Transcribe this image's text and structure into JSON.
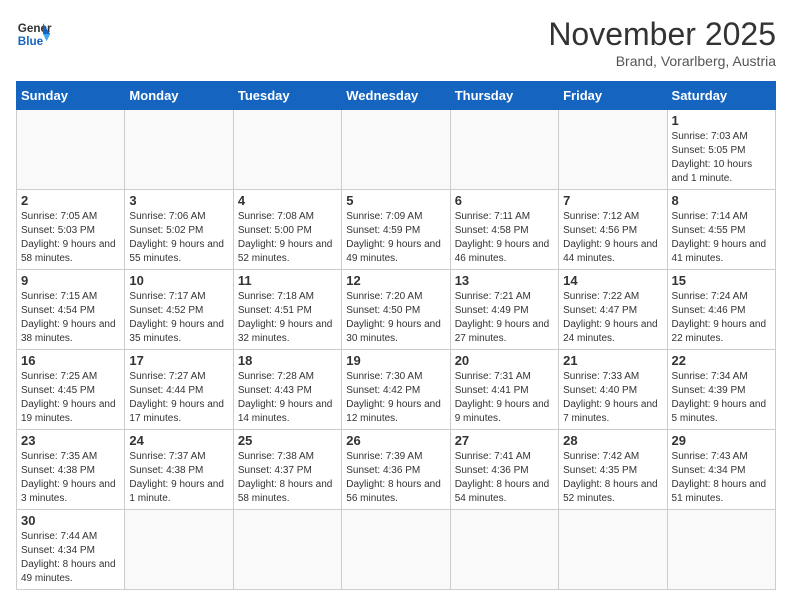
{
  "header": {
    "logo_general": "General",
    "logo_blue": "Blue",
    "month_title": "November 2025",
    "subtitle": "Brand, Vorarlberg, Austria"
  },
  "weekdays": [
    "Sunday",
    "Monday",
    "Tuesday",
    "Wednesday",
    "Thursday",
    "Friday",
    "Saturday"
  ],
  "weeks": [
    [
      {
        "day": "",
        "info": ""
      },
      {
        "day": "",
        "info": ""
      },
      {
        "day": "",
        "info": ""
      },
      {
        "day": "",
        "info": ""
      },
      {
        "day": "",
        "info": ""
      },
      {
        "day": "",
        "info": ""
      },
      {
        "day": "1",
        "info": "Sunrise: 7:03 AM\nSunset: 5:05 PM\nDaylight: 10 hours and 1 minute."
      }
    ],
    [
      {
        "day": "2",
        "info": "Sunrise: 7:05 AM\nSunset: 5:03 PM\nDaylight: 9 hours and 58 minutes."
      },
      {
        "day": "3",
        "info": "Sunrise: 7:06 AM\nSunset: 5:02 PM\nDaylight: 9 hours and 55 minutes."
      },
      {
        "day": "4",
        "info": "Sunrise: 7:08 AM\nSunset: 5:00 PM\nDaylight: 9 hours and 52 minutes."
      },
      {
        "day": "5",
        "info": "Sunrise: 7:09 AM\nSunset: 4:59 PM\nDaylight: 9 hours and 49 minutes."
      },
      {
        "day": "6",
        "info": "Sunrise: 7:11 AM\nSunset: 4:58 PM\nDaylight: 9 hours and 46 minutes."
      },
      {
        "day": "7",
        "info": "Sunrise: 7:12 AM\nSunset: 4:56 PM\nDaylight: 9 hours and 44 minutes."
      },
      {
        "day": "8",
        "info": "Sunrise: 7:14 AM\nSunset: 4:55 PM\nDaylight: 9 hours and 41 minutes."
      }
    ],
    [
      {
        "day": "9",
        "info": "Sunrise: 7:15 AM\nSunset: 4:54 PM\nDaylight: 9 hours and 38 minutes."
      },
      {
        "day": "10",
        "info": "Sunrise: 7:17 AM\nSunset: 4:52 PM\nDaylight: 9 hours and 35 minutes."
      },
      {
        "day": "11",
        "info": "Sunrise: 7:18 AM\nSunset: 4:51 PM\nDaylight: 9 hours and 32 minutes."
      },
      {
        "day": "12",
        "info": "Sunrise: 7:20 AM\nSunset: 4:50 PM\nDaylight: 9 hours and 30 minutes."
      },
      {
        "day": "13",
        "info": "Sunrise: 7:21 AM\nSunset: 4:49 PM\nDaylight: 9 hours and 27 minutes."
      },
      {
        "day": "14",
        "info": "Sunrise: 7:22 AM\nSunset: 4:47 PM\nDaylight: 9 hours and 24 minutes."
      },
      {
        "day": "15",
        "info": "Sunrise: 7:24 AM\nSunset: 4:46 PM\nDaylight: 9 hours and 22 minutes."
      }
    ],
    [
      {
        "day": "16",
        "info": "Sunrise: 7:25 AM\nSunset: 4:45 PM\nDaylight: 9 hours and 19 minutes."
      },
      {
        "day": "17",
        "info": "Sunrise: 7:27 AM\nSunset: 4:44 PM\nDaylight: 9 hours and 17 minutes."
      },
      {
        "day": "18",
        "info": "Sunrise: 7:28 AM\nSunset: 4:43 PM\nDaylight: 9 hours and 14 minutes."
      },
      {
        "day": "19",
        "info": "Sunrise: 7:30 AM\nSunset: 4:42 PM\nDaylight: 9 hours and 12 minutes."
      },
      {
        "day": "20",
        "info": "Sunrise: 7:31 AM\nSunset: 4:41 PM\nDaylight: 9 hours and 9 minutes."
      },
      {
        "day": "21",
        "info": "Sunrise: 7:33 AM\nSunset: 4:40 PM\nDaylight: 9 hours and 7 minutes."
      },
      {
        "day": "22",
        "info": "Sunrise: 7:34 AM\nSunset: 4:39 PM\nDaylight: 9 hours and 5 minutes."
      }
    ],
    [
      {
        "day": "23",
        "info": "Sunrise: 7:35 AM\nSunset: 4:38 PM\nDaylight: 9 hours and 3 minutes."
      },
      {
        "day": "24",
        "info": "Sunrise: 7:37 AM\nSunset: 4:38 PM\nDaylight: 9 hours and 1 minute."
      },
      {
        "day": "25",
        "info": "Sunrise: 7:38 AM\nSunset: 4:37 PM\nDaylight: 8 hours and 58 minutes."
      },
      {
        "day": "26",
        "info": "Sunrise: 7:39 AM\nSunset: 4:36 PM\nDaylight: 8 hours and 56 minutes."
      },
      {
        "day": "27",
        "info": "Sunrise: 7:41 AM\nSunset: 4:36 PM\nDaylight: 8 hours and 54 minutes."
      },
      {
        "day": "28",
        "info": "Sunrise: 7:42 AM\nSunset: 4:35 PM\nDaylight: 8 hours and 52 minutes."
      },
      {
        "day": "29",
        "info": "Sunrise: 7:43 AM\nSunset: 4:34 PM\nDaylight: 8 hours and 51 minutes."
      }
    ],
    [
      {
        "day": "30",
        "info": "Sunrise: 7:44 AM\nSunset: 4:34 PM\nDaylight: 8 hours and 49 minutes."
      },
      {
        "day": "",
        "info": ""
      },
      {
        "day": "",
        "info": ""
      },
      {
        "day": "",
        "info": ""
      },
      {
        "day": "",
        "info": ""
      },
      {
        "day": "",
        "info": ""
      },
      {
        "day": "",
        "info": ""
      }
    ]
  ]
}
